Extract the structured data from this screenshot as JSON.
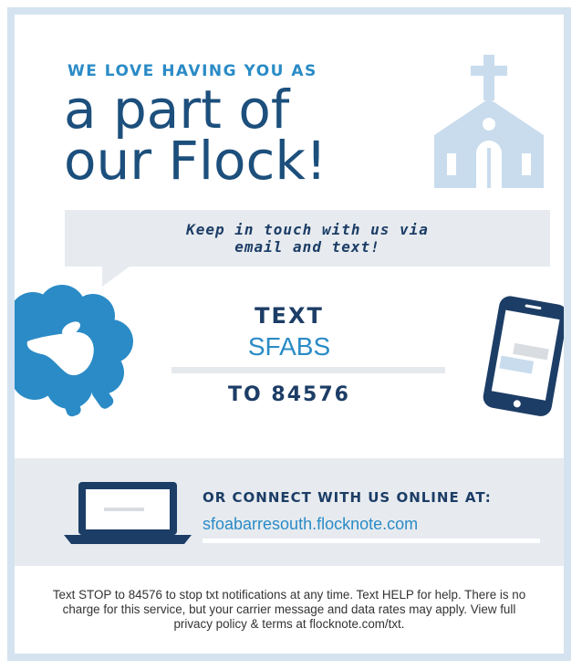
{
  "header": {
    "eyebrow": "WE LOVE HAVING YOU AS",
    "headline_line1": "a part of",
    "headline_line2": "our Flock!"
  },
  "bubble": {
    "line1": "Keep in touch with us via",
    "line2": "email and text!"
  },
  "sms": {
    "text_label": "TEXT",
    "keyword": "SFABS",
    "to_number": "TO 84576"
  },
  "online": {
    "label": "OR CONNECT WITH US ONLINE AT:",
    "url": "sfoabarresouth.flocknote.com"
  },
  "footer": {
    "disclaimer": "Text STOP to 84576 to stop txt notifications at any time. Text HELP for help. There is no charge for this service, but your carrier message and data rates may apply. View full privacy policy & terms at flocknote.com/txt."
  },
  "icons": {
    "church": "church-icon",
    "sheep": "sheep-icon",
    "phone": "phone-icon",
    "laptop": "laptop-icon"
  },
  "colors": {
    "accent_blue": "#2a8bc6",
    "navy": "#1c3d66",
    "headline_navy": "#1c4f7c",
    "light_gray": "#e7ebef",
    "church_blue": "#c9dced",
    "border_blue": "#d5e3f0"
  }
}
